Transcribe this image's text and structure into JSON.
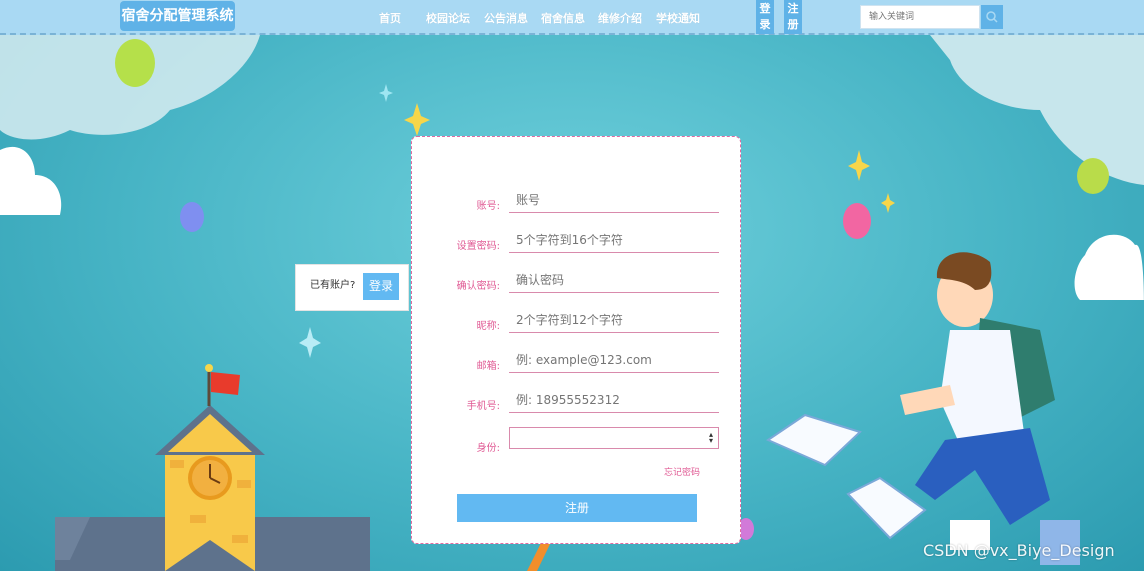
{
  "header": {
    "logo": "宿舍分配管理系统",
    "nav": [
      "首页",
      "校园论坛",
      "公告消息",
      "宿舍信息",
      "维修介绍",
      "学校通知"
    ],
    "login": "登录",
    "register": "注册",
    "search_placeholder": "输入关键词"
  },
  "side_login": {
    "prompt": "已有账户?",
    "button": "登录"
  },
  "form": {
    "fields": [
      {
        "label": "账号:",
        "placeholder": "账号"
      },
      {
        "label": "设置密码:",
        "placeholder": "5个字符到16个字符"
      },
      {
        "label": "确认密码:",
        "placeholder": "确认密码"
      },
      {
        "label": "昵称:",
        "placeholder": "2个字符到12个字符"
      },
      {
        "label": "邮箱:",
        "placeholder": "例: example@123.com"
      },
      {
        "label": "手机号:",
        "placeholder": "例: 18955552312"
      }
    ],
    "identity_label": "身份:",
    "forgot": "忘记密码",
    "submit": "注册"
  },
  "watermark": "CSDN @vx_Biye_Design",
  "colors": {
    "accent": "#62b9f2",
    "label": "#e05a94",
    "header_bg": "#a9d9f3"
  }
}
